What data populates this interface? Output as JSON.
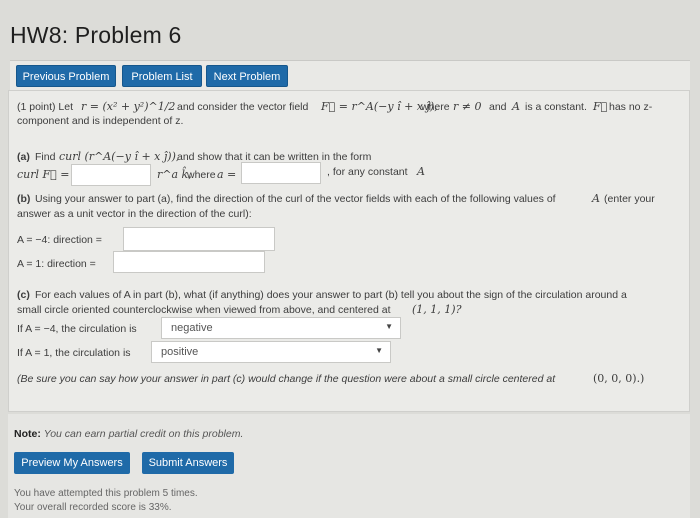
{
  "page_title": "HW8: Problem 6",
  "nav": {
    "prev": "Previous Problem",
    "list": "Problem List",
    "next": "Next Problem"
  },
  "problem": {
    "intro1_a": "(1 point) Let",
    "intro1_math1": "r = (x² + y²)^1/2",
    "intro1_b": "and consider the vector field",
    "intro1_math2": "F⃗ = r^A(−y î + x ĵ),",
    "intro1_c": "where",
    "intro1_math3": "r ≠ 0",
    "intro1_d": "and",
    "intro1_math4": "A",
    "intro1_e": "is a constant.",
    "intro1_math5": "F⃗",
    "intro1_f": "has no z-",
    "intro2": "component and is independent of z.",
    "a_label": "(a)",
    "a_text1": "Find",
    "a_math1": "curl (r^A(−y î + x ĵ)),",
    "a_text2": "and show that it can be written in the form",
    "a_curl_label": "curl F⃗ =",
    "a_math2": "r^a k̂,",
    "a_text3": "where",
    "a_math3": "a =",
    "a_text4": ", for any constant",
    "a_math4": "A",
    "b_label": "(b)",
    "b_text1": "Using your answer to part (a), find the direction of the curl of the vector fields with each of the following values of",
    "b_math1": "A",
    "b_text2": "(enter your",
    "b_text3": "answer as a unit vector in the direction of the curl):",
    "b_row1": "A = −4: direction =",
    "b_row2": "A = 1: direction =",
    "c_label": "(c)",
    "c_text1": "For each values of A in part (b), what (if anything) does your answer to part (b) tell you about the sign of the circulation around a",
    "c_text2": "small circle oriented counterclockwise when viewed from above, and centered at",
    "c_math1": "(1, 1, 1)?",
    "c_row1": "If A = −4, the circulation is",
    "c_row1_value": "negative",
    "c_row2": "If A = 1, the circulation is",
    "c_row2_value": "positive",
    "c_hint": "(Be sure you can say how your answer in part (c) would change if the question were about a small circle centered at",
    "c_hint_math": "(0, 0, 0).)"
  },
  "footer": {
    "note_label": "Note:",
    "note_text": "You can earn partial credit on this problem.",
    "preview": "Preview My Answers",
    "submit": "Submit Answers",
    "attempts": "You have attempted this problem 5 times.",
    "score": "Your overall recorded score is 33%."
  }
}
